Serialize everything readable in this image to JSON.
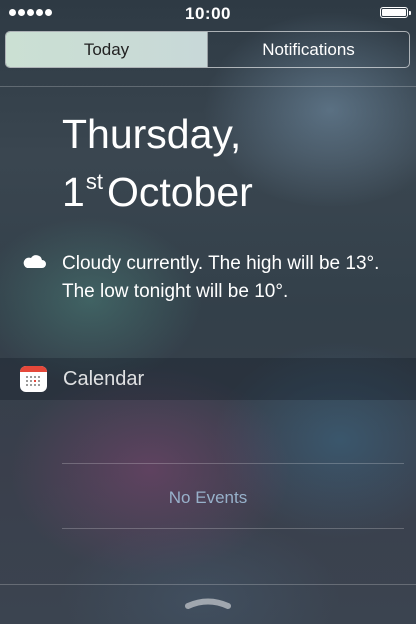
{
  "status_bar": {
    "time": "10:00",
    "signal_dots": 5,
    "battery_level": 1.0
  },
  "tabs": [
    {
      "label": "Today",
      "selected": true
    },
    {
      "label": "Notifications",
      "selected": false
    }
  ],
  "date": {
    "weekday": "Thursday,",
    "day": "1",
    "ordinal": "st",
    "month": "October"
  },
  "weather": {
    "icon": "cloud-icon",
    "summary": "Cloudy currently. The high will be 13°. The low tonight will be 10°."
  },
  "calendar": {
    "icon": "calendar-icon",
    "title": "Calendar",
    "empty_text": "No Events"
  },
  "grabber": {
    "icon": "grabber-handle-icon"
  },
  "colors": {
    "selected_tab": "#cbe0d3",
    "calendar_band": "#e5483a",
    "no_events_text": "#a0bed7"
  }
}
